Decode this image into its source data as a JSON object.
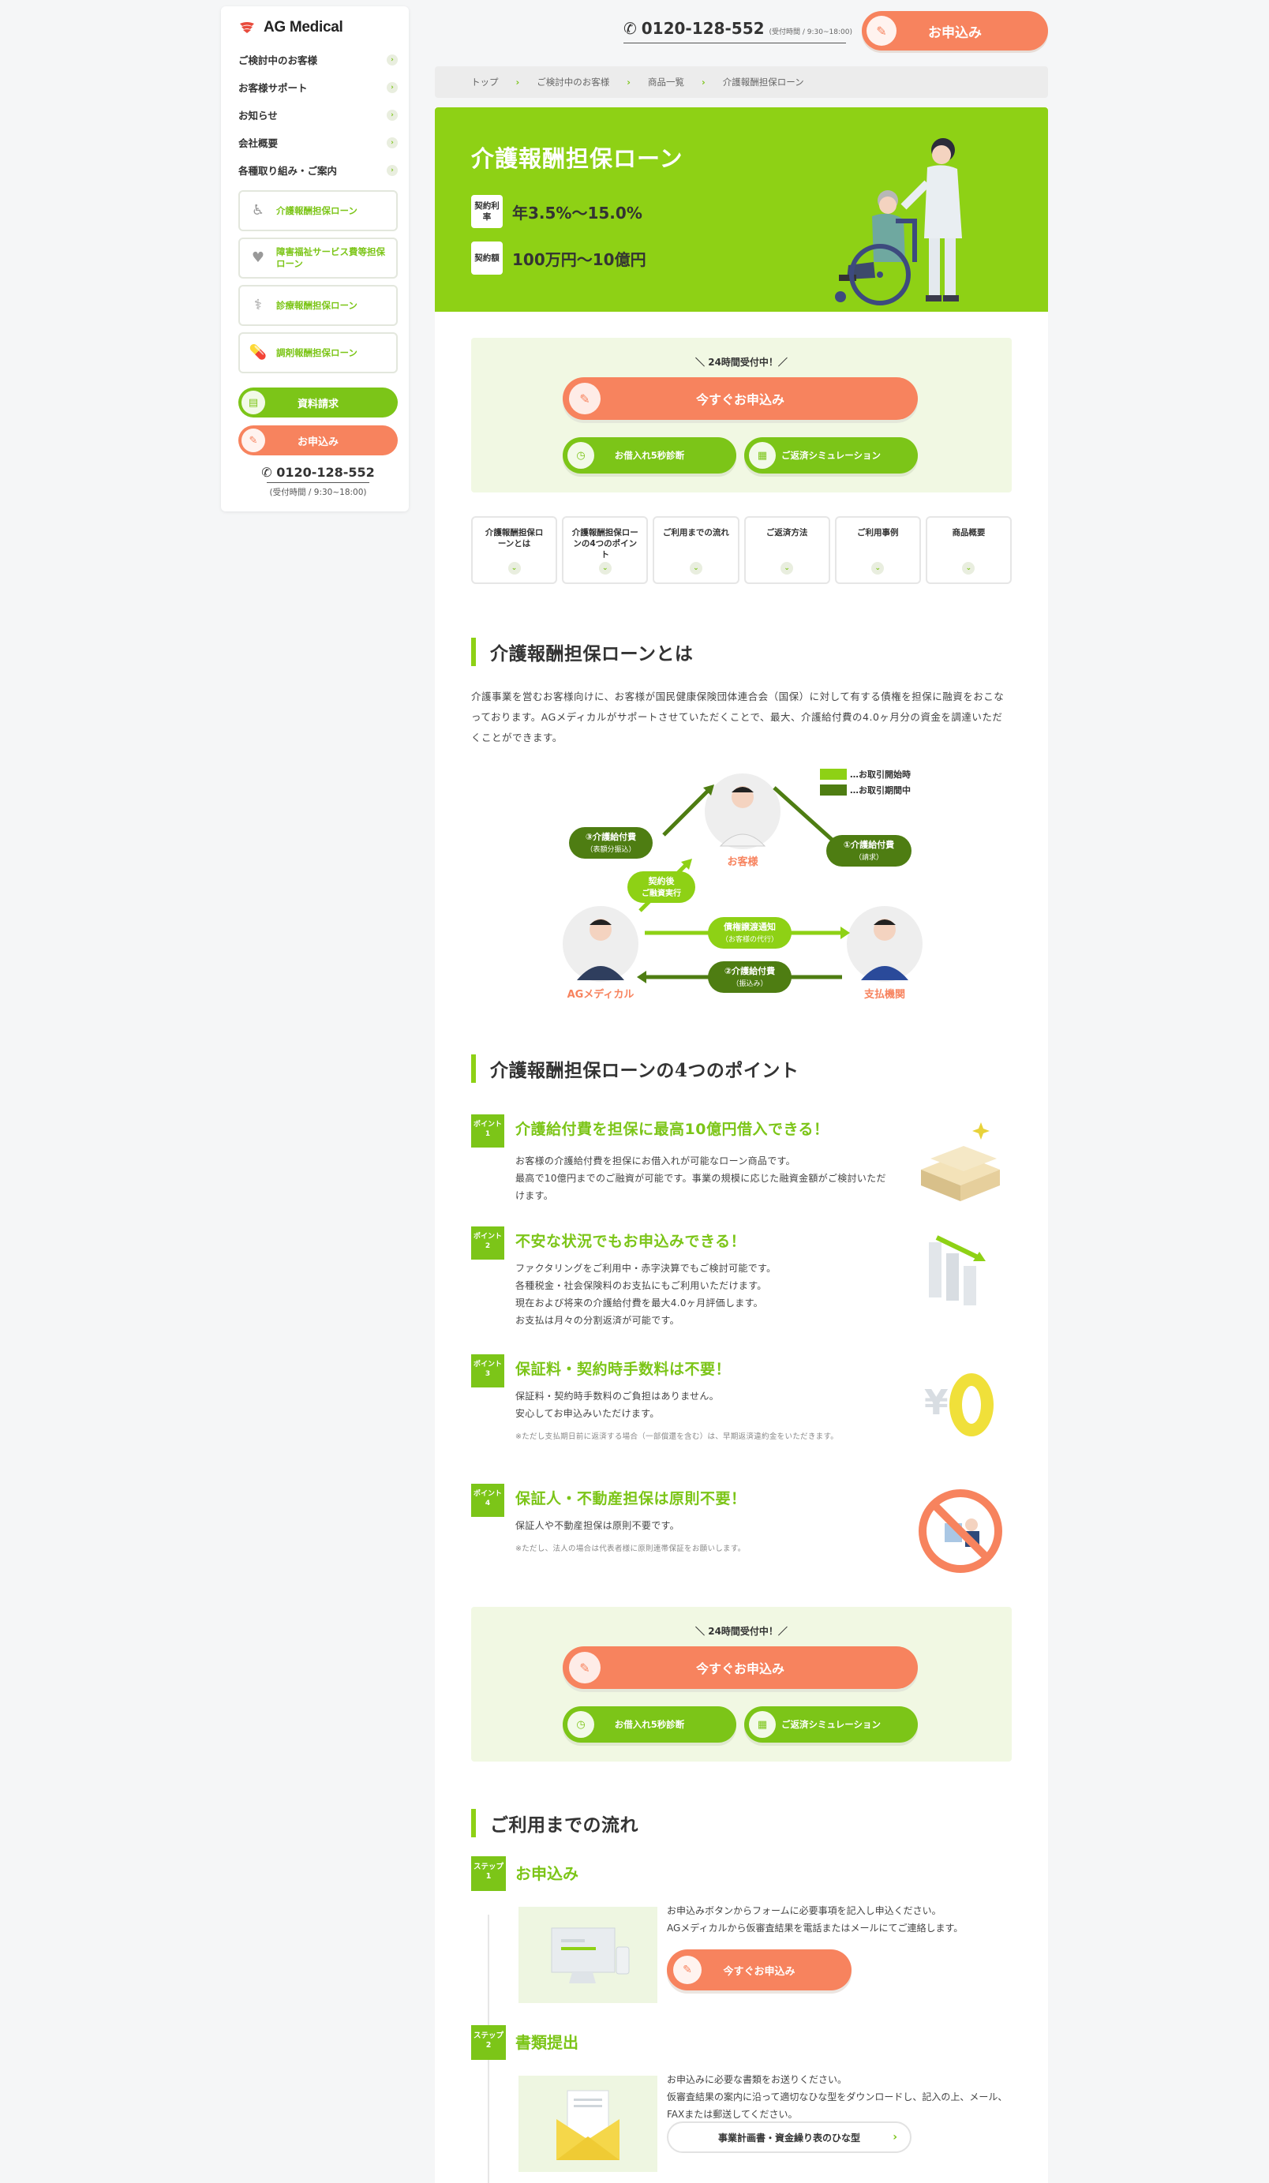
{
  "brand": {
    "name": "AG Medical"
  },
  "sidebar": {
    "nav": [
      {
        "label": "ご検討中のお客様"
      },
      {
        "label": "お客様サポート"
      },
      {
        "label": "お知らせ"
      },
      {
        "label": "会社概要"
      },
      {
        "label": "各種取り組み・ご案内"
      }
    ],
    "products": [
      {
        "label": "介護報酬担保ローン",
        "icon": "wheelchair-icon"
      },
      {
        "label": "障害福祉サービス費等担保ローン",
        "icon": "hand-heart-icon"
      },
      {
        "label": "診療報酬担保ローン",
        "icon": "stethoscope-icon"
      },
      {
        "label": "調剤報酬担保ローン",
        "icon": "pill-icon"
      }
    ],
    "request_label": "資料請求",
    "apply_label": "お申込み",
    "phone": "0120-128-552",
    "hours": "(受付時間 / 9:30~18:00)"
  },
  "header": {
    "phone": "0120-128-552",
    "hours": "(受付時間 / 9:30~18:00)",
    "cta_label": "お申込み"
  },
  "breadcrumb": [
    "トップ",
    "ご検討中のお客様",
    "商品一覧",
    "介護報酬担保ローン"
  ],
  "hero": {
    "title": "介護報酬担保ローン",
    "rate_tag": "契約利率",
    "rate_value": "年3.5%～15.0%",
    "amount_tag": "契約額",
    "amount_value": "100万円～10億円"
  },
  "cta": {
    "note": "＼ 24時間受付中！／",
    "main_label": "今すぐお申込み",
    "diagnosis_label": "お借入れ5秒診断",
    "simulation_label": "ご返済シミュレーション"
  },
  "tabs": [
    "介護報酬担保ローンとは",
    "介護報酬担保ローンの4つのポイント",
    "ご利用までの流れ",
    "ご返済方法",
    "ご利用事例",
    "商品概要"
  ],
  "about": {
    "heading": "介護報酬担保ローンとは",
    "body": "介護事業を営むお客様向けに、お客様が国民健康保険団体連合会（国保）に対して有する債権を担保に融資をおこなっております。AGメディカルがサポートさせていただくことで、最大、介護給付費の4.0ヶ月分の資金を調達いただくことができます。"
  },
  "diagram": {
    "customer": "お客様",
    "agm": "AGメディカル",
    "payer": "支払機関",
    "legend_start": "…お取引開始時",
    "legend_during": "…お取引期間中",
    "arrow1": "①介護給付費",
    "arrow1_sub": "（請求）",
    "arrow2": "②介護給付費",
    "arrow2_sub": "（振込み）",
    "arrow3": "③介護給付費",
    "arrow3_sub": "（表額分振込）",
    "contract": "契約後",
    "contract_sub": "ご融資実行",
    "notice": "債権譲渡通知",
    "notice_sub": "（お客様の代行）"
  },
  "points": {
    "heading": "介護報酬担保ローンの4つのポイント",
    "badge": "ポイント",
    "items": [
      {
        "num": "1",
        "title": "介護給付費を担保に最高10億円借入できる！",
        "lines": [
          "お客様の介護給付費を担保にお借入れが可能なローン商品です。",
          "最高で10億円までのご融資が可能です。事業の規模に応じた融資金額がご検討いただけます。"
        ],
        "note": ""
      },
      {
        "num": "2",
        "title": "不安な状況でもお申込みできる！",
        "lines": [
          "ファクタリングをご利用中・赤字決算でもご検討可能です。",
          "各種税金・社会保険料のお支払にもご利用いただけます。",
          "現在および将来の介護給付費を最大4.0ヶ月評価します。",
          "お支払は月々の分割返済が可能です。"
        ],
        "note": ""
      },
      {
        "num": "3",
        "title": "保証料・契約時手数料は不要！",
        "lines": [
          "保証料・契約時手数料のご負担はありません。",
          "安心してお申込みいただけます。"
        ],
        "note": "※ただし支払期日前に返済する場合（一部償還を含む）は、早期返済違約金をいただきます。"
      },
      {
        "num": "4",
        "title": "保証人・不動産担保は原則不要！",
        "lines": [
          "保証人や不動産担保は原則不要です。"
        ],
        "note": "※ただし、法人の場合は代表者様に原則連帯保証をお願いします。"
      }
    ]
  },
  "flow": {
    "heading": "ご利用までの流れ",
    "badge": "ステップ",
    "steps": [
      {
        "num": "1",
        "title": "お申込み",
        "lines": [
          "お申込みボタンからフォームに必要事項を記入し申込ください。",
          "AGメディカルから仮審査結果を電話またはメールにてご連絡します。"
        ],
        "button": "今すぐお申込み"
      },
      {
        "num": "2",
        "title": "書類提出",
        "lines": [
          "お申込みに必要な書類をお送りください。",
          "仮審査結果の案内に沿って適切なひな型をダウンロードし、記入の上、メール、FAXまたは郵送してください。"
        ],
        "button": "事業計画書・資金繰り表のひな型"
      }
    ]
  },
  "colors": {
    "green": "#7cc518",
    "hero": "#8ed115",
    "orange": "#f7835e",
    "dark_green": "#4e7d12"
  }
}
